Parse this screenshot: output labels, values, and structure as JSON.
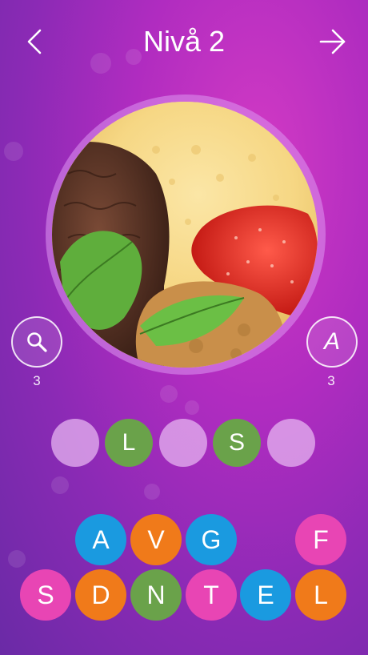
{
  "header": {
    "back_icon": "chevron-left-icon",
    "title": "Nivå 2",
    "next_icon": "arrow-right-icon"
  },
  "puzzle_image": {
    "description_icon": "ice-cream-photo"
  },
  "hints": {
    "reveal": {
      "icon": "magnifier-icon",
      "count": "3"
    },
    "letter": {
      "icon_text": "A",
      "count": "3"
    }
  },
  "answer_slots": [
    {
      "letter": "",
      "state": "empty"
    },
    {
      "letter": "L",
      "state": "filled"
    },
    {
      "letter": "",
      "state": "empty"
    },
    {
      "letter": "S",
      "state": "filled"
    },
    {
      "letter": "",
      "state": "empty"
    }
  ],
  "keyboard": {
    "row1": [
      {
        "letter": "A",
        "color": "#1a9ae0"
      },
      {
        "letter": "V",
        "color": "#f07a1a"
      },
      {
        "letter": "G",
        "color": "#1a9ae0"
      },
      {
        "letter": "",
        "color": ""
      },
      {
        "letter": "F",
        "color": "#e845b4"
      }
    ],
    "row2": [
      {
        "letter": "S",
        "color": "#e845b4"
      },
      {
        "letter": "D",
        "color": "#f07a1a"
      },
      {
        "letter": "N",
        "color": "#6aa24a"
      },
      {
        "letter": "T",
        "color": "#e845b4"
      },
      {
        "letter": "E",
        "color": "#1a9ae0"
      },
      {
        "letter": "L",
        "color": "#f07a1a"
      }
    ]
  },
  "colors": {
    "slot_filled": "#6aa24a",
    "slot_empty": "#e6b4f0"
  }
}
